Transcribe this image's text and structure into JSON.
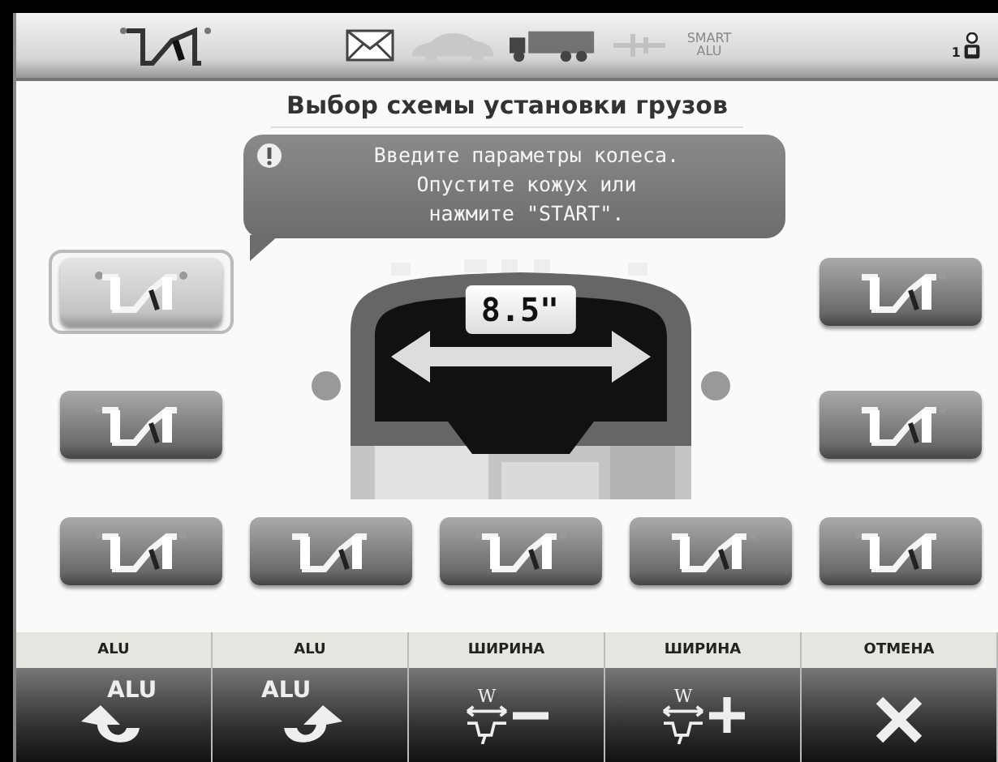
{
  "header": {
    "modes": [
      {
        "kind": "car",
        "selected": false
      },
      {
        "kind": "truck",
        "selected": true
      }
    ],
    "smart_alu": {
      "label": "SMART ALU",
      "disabled": true
    },
    "user": {
      "number": "1"
    }
  },
  "title": "Выбор схемы установки грузов",
  "message": [
    "Введите параметры колеса.",
    "Опустите кожух или",
    "нажмите \"START\"."
  ],
  "rim_width": "8.5\"",
  "schemes": [
    {
      "selected": true
    },
    {
      "selected": false
    },
    {
      "selected": false
    },
    {
      "selected": false
    },
    {
      "selected": false
    },
    {
      "selected": false
    },
    {
      "selected": false
    },
    {
      "selected": false
    },
    {
      "selected": false
    }
  ],
  "softkeys": [
    {
      "label": "ALU",
      "kind": "alu-left",
      "icon_text": "ALU"
    },
    {
      "label": "ALU",
      "kind": "alu-right",
      "icon_text": "ALU"
    },
    {
      "label": "ШИРИНА",
      "kind": "width-minus",
      "icon_text": "W"
    },
    {
      "label": "ШИРИНА",
      "kind": "width-plus",
      "icon_text": "W"
    },
    {
      "label": "ОТМЕНА",
      "kind": "cancel"
    }
  ]
}
